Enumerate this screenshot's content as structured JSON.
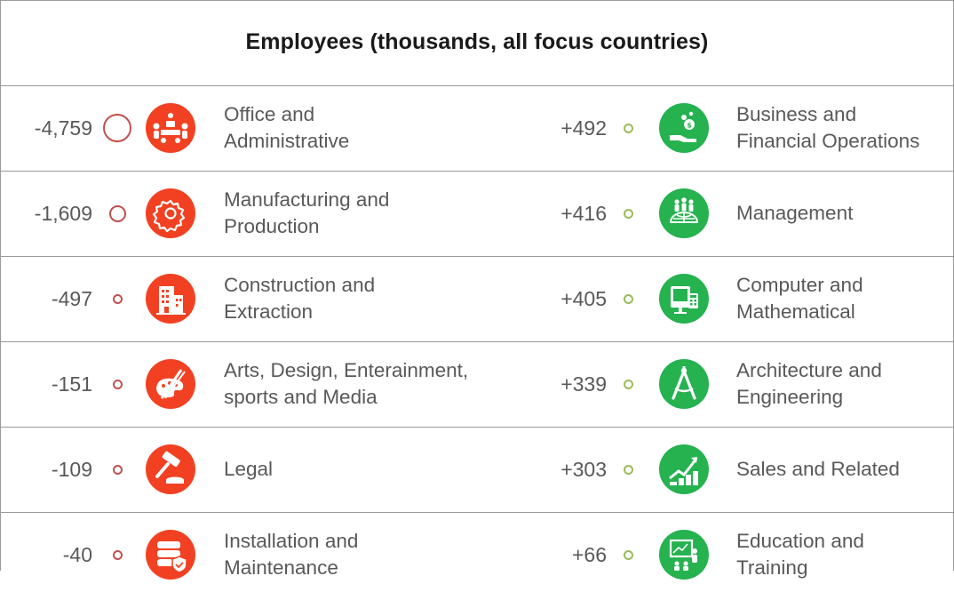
{
  "chart_data": {
    "type": "table",
    "title": "Employees (thousands, all focus countries)",
    "declining": [
      {
        "value": "-4,759",
        "number": -4759,
        "label": "Office and\nAdministrative",
        "icon": "office-meeting-icon"
      },
      {
        "value": "-1,609",
        "number": -1609,
        "label": "Manufacturing and\nProduction",
        "icon": "gear-icon"
      },
      {
        "value": "-497",
        "number": -497,
        "label": "Construction and\nExtraction",
        "icon": "building-icon"
      },
      {
        "value": "-151",
        "number": -151,
        "label": "Arts, Design, Enterainment,\nsports and Media",
        "icon": "palette-brush-icon"
      },
      {
        "value": "-109",
        "number": -109,
        "label": "Legal",
        "icon": "gavel-icon"
      },
      {
        "value": "-40",
        "number": -40,
        "label": "Installation and\nMaintenance",
        "icon": "server-shield-icon"
      }
    ],
    "growing": [
      {
        "value": "+492",
        "number": 492,
        "label": "Business and\nFinancial Operations",
        "icon": "hand-coins-icon"
      },
      {
        "value": "+416",
        "number": 416,
        "label": "Management",
        "icon": "people-globe-icon"
      },
      {
        "value": "+405",
        "number": 405,
        "label": "Computer and\nMathematical",
        "icon": "computer-calculator-icon"
      },
      {
        "value": "+339",
        "number": 339,
        "label": "Architecture and\nEngineering",
        "icon": "compass-icon"
      },
      {
        "value": "+303",
        "number": 303,
        "label": "Sales and Related",
        "icon": "growth-chart-icon"
      },
      {
        "value": "+66",
        "number": 66,
        "label": "Education and\nTraining",
        "icon": "presentation-icon"
      }
    ],
    "colors": {
      "negative": "#c0504d",
      "positive": "#9bbb59",
      "negative_badge": "#f24122",
      "positive_badge": "#25b24f"
    }
  }
}
